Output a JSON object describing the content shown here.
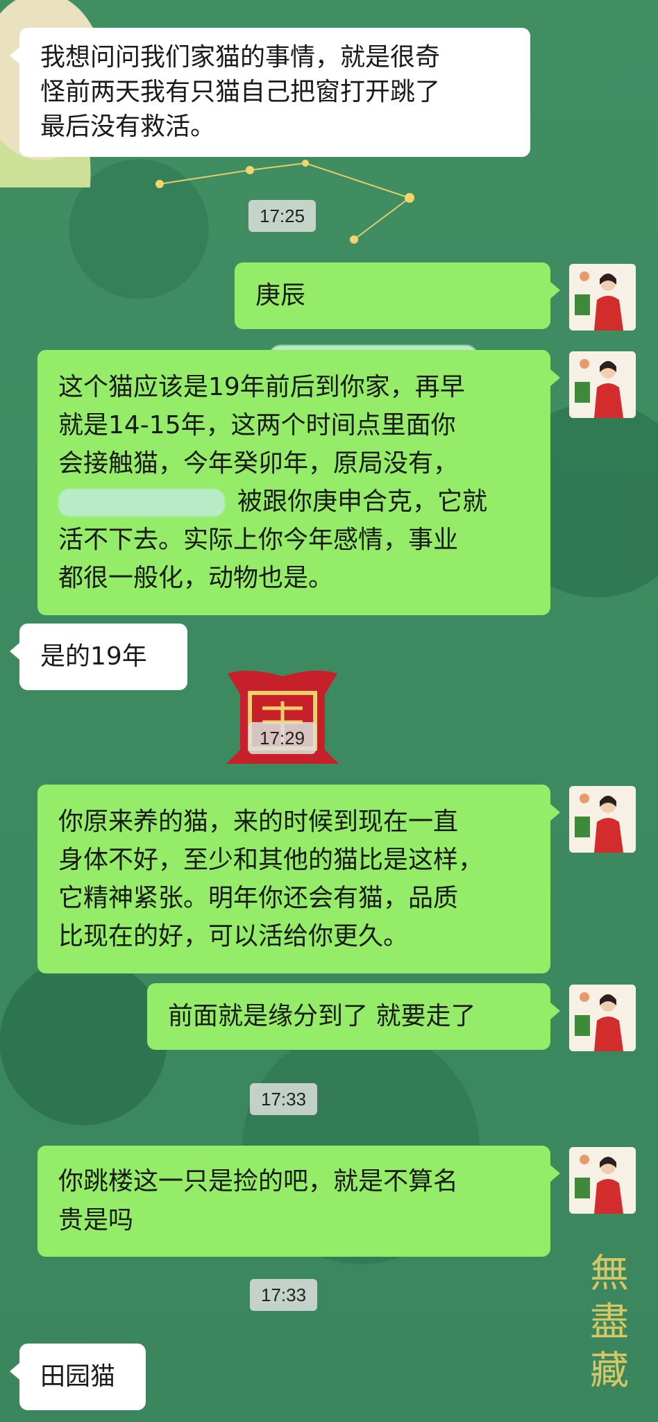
{
  "messages": [
    {
      "side": "left",
      "text_lines": [
        "我想问问我们家猫的事情，就是很奇",
        "怪前两天我有只猫自己把窗打开跳了",
        "最后没有救活。"
      ]
    },
    {
      "time": "17:25"
    },
    {
      "side": "right",
      "text": "庚辰"
    },
    {
      "side": "right",
      "text_lines": [
        "这个猫应该是19年前后到你家，再早",
        "就是14-15年，这两个时间点里面你",
        "会接触猫，今年癸卯年，原局没有，",
        "被跟你庚申合克，它就",
        "活不下去。实际上你今年感情，事业",
        "都很一般化，动物也是。"
      ]
    },
    {
      "side": "left",
      "text": "是的19年"
    },
    {
      "time": "17:29"
    },
    {
      "side": "right",
      "text_lines": [
        "你原来养的猫，来的时候到现在一直",
        "身体不好，至少和其他的猫比是这样，",
        "它精神紧张。明年你还会有猫，品质",
        "比现在的好，可以活给你更久。"
      ]
    },
    {
      "side": "right",
      "text": "前面就是缘分到了  就要走了"
    },
    {
      "time": "17:33"
    },
    {
      "side": "right",
      "text_lines": [
        "你跳楼这一只是捡的吧，就是不算名",
        "贵是吗"
      ]
    },
    {
      "time": "17:33"
    },
    {
      "side": "left",
      "text": "田园猫"
    }
  ],
  "watermark": [
    "無",
    "盡",
    "藏"
  ],
  "colors": {
    "left_bubble": "#ffffff",
    "right_bubble": "#95ec69",
    "background": "#3f8a62"
  }
}
